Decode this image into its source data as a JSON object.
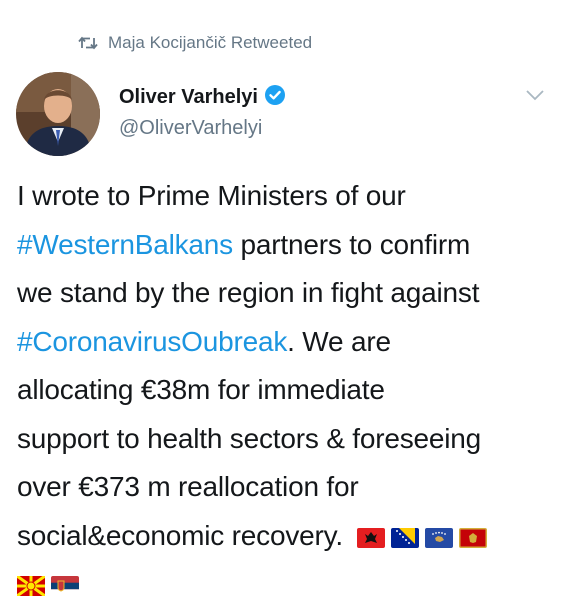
{
  "retweet": {
    "icon": "retweet-icon",
    "text": "Maja Kocijančič Retweeted"
  },
  "author": {
    "avatar_icon": "avatar",
    "name": "Oliver Varhelyi",
    "verified_icon": "verified-badge-icon",
    "handle": "@OliverVarhelyi"
  },
  "menu": {
    "icon": "chevron-down-icon"
  },
  "tweet": {
    "lines": [
      [
        "I wrote to Prime Ministers of our"
      ],
      [
        "#WesternBalkans",
        " partners to confirm"
      ],
      [
        "we stand by the region in fight against"
      ],
      [
        "#CoronavirusOubreak",
        ". We are"
      ],
      [
        "allocating €38m for immediate"
      ],
      [
        "support to health sectors & foreseeing"
      ],
      [
        "over €373 m reallocation for"
      ],
      [
        "social&economic recovery. "
      ]
    ],
    "flags": [
      "albania-flag-icon",
      "bosnia-flag-icon",
      "kosovo-flag-icon",
      "montenegro-flag-icon",
      "north-macedonia-flag-icon",
      "serbia-flag-icon"
    ]
  },
  "colors": {
    "hashtag": "#1b95e0",
    "secondary_text": "#657786",
    "verified": "#1da1f2"
  }
}
